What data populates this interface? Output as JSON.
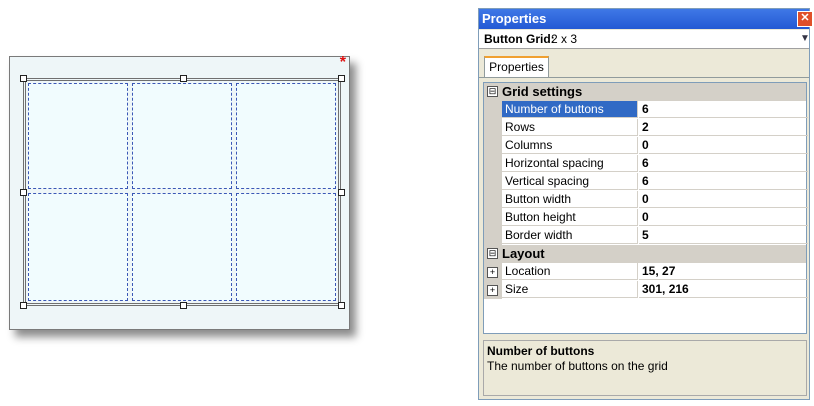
{
  "designer": {
    "required_marker": "*",
    "grid": {
      "rows": 2,
      "columns": 3
    }
  },
  "properties_panel": {
    "title": "Properties",
    "selector": {
      "label": "Button Grid:",
      "value": "2 x 3"
    },
    "tab": "Properties",
    "categories": [
      {
        "name": "Grid settings",
        "collapse_glyph": "⊟",
        "properties": [
          {
            "name": "Number of buttons",
            "value": "6",
            "selected": true
          },
          {
            "name": "Rows",
            "value": "2"
          },
          {
            "name": "Columns",
            "value": "0"
          },
          {
            "name": "Horizontal spacing",
            "value": "6"
          },
          {
            "name": "Vertical spacing",
            "value": "6"
          },
          {
            "name": "Button width",
            "value": "0"
          },
          {
            "name": "Button height",
            "value": "0"
          },
          {
            "name": "Border width",
            "value": "5"
          }
        ]
      },
      {
        "name": "Layout",
        "collapse_glyph": "⊟",
        "properties": [
          {
            "name": "Location",
            "value": "15, 27",
            "expandable": true
          },
          {
            "name": "Size",
            "value": "301, 216",
            "expandable": true
          }
        ]
      }
    ],
    "help": {
      "title": "Number of buttons",
      "description": "The number of buttons on the grid"
    }
  }
}
